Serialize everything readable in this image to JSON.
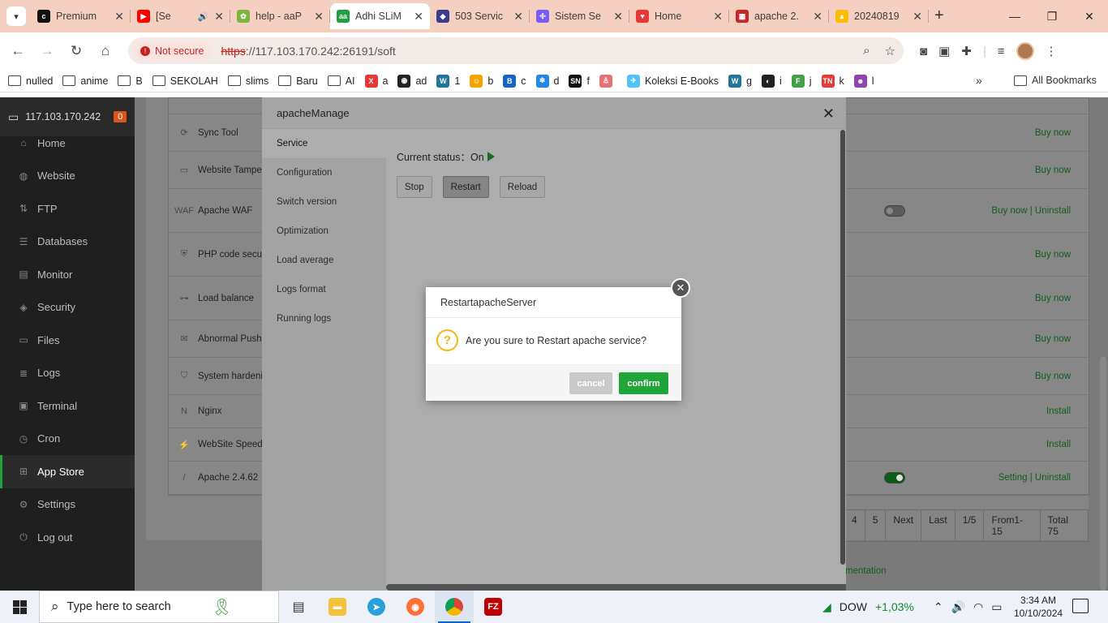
{
  "browser": {
    "tabs": [
      {
        "title": "Premium",
        "color": "#111111",
        "glyph": "c"
      },
      {
        "title": "[Se",
        "color": "#ff0000",
        "glyph": "▶",
        "audio": true
      },
      {
        "title": "help - aaP",
        "color": "#7cb342",
        "glyph": "✿"
      },
      {
        "title": "Adhi SLiM",
        "color": "#1ea043",
        "glyph": "aa",
        "active": true
      },
      {
        "title": "503 Servic",
        "color": "#3c3c8c",
        "glyph": "◆"
      },
      {
        "title": "Sistem Se",
        "color": "#7a5af8",
        "glyph": "✣"
      },
      {
        "title": "Home",
        "color": "#e53935",
        "glyph": "♥"
      },
      {
        "title": "apache 2.",
        "color": "#c62828",
        "glyph": "▦"
      },
      {
        "title": "20240819",
        "color": "#fbbc04",
        "glyph": "▲"
      }
    ],
    "not_secure_label": "Not secure",
    "url_scheme": "https",
    "url_rest": "://117.103.170.242:26191/soft",
    "bookmarks": [
      {
        "label": "nulled",
        "type": "folder"
      },
      {
        "label": "anime",
        "type": "folder"
      },
      {
        "label": "B",
        "type": "folder"
      },
      {
        "label": "SEKOLAH",
        "type": "folder"
      },
      {
        "label": "slims",
        "type": "folder"
      },
      {
        "label": "Baru",
        "type": "folder"
      },
      {
        "label": "AI",
        "type": "folder"
      },
      {
        "label": "a",
        "type": "icon",
        "color": "#e53935",
        "glyph": "X"
      },
      {
        "label": "ad",
        "type": "icon",
        "color": "#222222",
        "glyph": "◉"
      },
      {
        "label": "1",
        "type": "icon",
        "color": "#21759b",
        "glyph": "W"
      },
      {
        "label": "b",
        "type": "icon",
        "color": "#f4a300",
        "glyph": "☺"
      },
      {
        "label": "c",
        "type": "icon",
        "color": "#1565c0",
        "glyph": "B"
      },
      {
        "label": "d",
        "type": "icon",
        "color": "#1e88e5",
        "glyph": "❄"
      },
      {
        "label": "f",
        "type": "icon",
        "color": "#111111",
        "glyph": "SN"
      },
      {
        "label": "",
        "type": "icon",
        "color": "#e57373",
        "glyph": "♙"
      },
      {
        "label": "Koleksi E-Books",
        "type": "icon",
        "color": "#4fc3f7",
        "glyph": "✈"
      },
      {
        "label": "g",
        "type": "icon",
        "color": "#21759b",
        "glyph": "W"
      },
      {
        "label": "i",
        "type": "icon",
        "color": "#222222",
        "glyph": "◐"
      },
      {
        "label": "j",
        "type": "icon",
        "color": "#43a047",
        "glyph": "F"
      },
      {
        "label": "k",
        "type": "icon",
        "color": "#e53935",
        "glyph": "TN"
      },
      {
        "label": "l",
        "type": "icon",
        "color": "#8e44ad",
        "glyph": "☻"
      }
    ],
    "all_bookmarks_label": "All Bookmarks"
  },
  "sidebar": {
    "host": "117.103.170.242",
    "badge": "0",
    "items": [
      {
        "label": "Home",
        "icon": "home-icon",
        "glyph": "⌂"
      },
      {
        "label": "Website",
        "icon": "globe-icon",
        "glyph": "◍"
      },
      {
        "label": "FTP",
        "icon": "ftp-icon",
        "glyph": "⇅"
      },
      {
        "label": "Databases",
        "icon": "database-icon",
        "glyph": "☰"
      },
      {
        "label": "Monitor",
        "icon": "monitor-icon",
        "glyph": "▤"
      },
      {
        "label": "Security",
        "icon": "shield-icon",
        "glyph": "◈"
      },
      {
        "label": "Files",
        "icon": "folder-icon",
        "glyph": "▭"
      },
      {
        "label": "Logs",
        "icon": "logs-icon",
        "glyph": "≣"
      },
      {
        "label": "Terminal",
        "icon": "terminal-icon",
        "glyph": "▣"
      },
      {
        "label": "Cron",
        "icon": "clock-icon",
        "glyph": "◷"
      },
      {
        "label": "App Store",
        "icon": "app-store-icon",
        "glyph": "⊞",
        "active": true
      },
      {
        "label": "Settings",
        "icon": "settings-icon",
        "glyph": "⚙"
      },
      {
        "label": "Log out",
        "icon": "logout-icon",
        "glyph": "⏻"
      }
    ]
  },
  "plugins": [
    {
      "name": "Sync Tool",
      "action": "Buy now",
      "glyph": "⟳"
    },
    {
      "name": "Website Tamper-proo",
      "action": "Buy now",
      "glyph": "▭"
    },
    {
      "name": "Apache WAF",
      "action": "Buy now | Uninstall",
      "glyph": "WAF",
      "toggle": "off"
    },
    {
      "name": "PHP code security",
      "action": "Buy now",
      "glyph": "⛨"
    },
    {
      "name": "Load balance",
      "action": "Buy now",
      "glyph": "⊶"
    },
    {
      "name": "Abnormal Push",
      "action": "Buy now",
      "glyph": "✉"
    },
    {
      "name": "System hardening",
      "action": "Buy now",
      "glyph": "⛉"
    },
    {
      "name": "Nginx",
      "action": "Install",
      "glyph": "N"
    },
    {
      "name": "WebSite Speed",
      "action": "Install",
      "glyph": "⚡"
    },
    {
      "name": "Apache 2.4.62",
      "action": "Setting | Uninstall",
      "glyph": "/",
      "toggle": "on"
    }
  ],
  "pagination": [
    "4",
    "5",
    "Next",
    "Last",
    "1/5",
    "From1-15",
    "Total 75"
  ],
  "doc_link": "mentation",
  "manage_dialog": {
    "title": "apacheManage",
    "nav": [
      "Service",
      "Configuration",
      "Switch version",
      "Optimization",
      "Load average",
      "Logs format",
      "Running logs"
    ],
    "active_nav": "Service",
    "status_label": "Current status：",
    "status_value": "On",
    "buttons": [
      "Stop",
      "Restart",
      "Reload"
    ]
  },
  "confirm_dialog": {
    "title": "RestartapacheServer",
    "message": "Are you sure to Restart apache service?",
    "cancel": "cancel",
    "confirm": "confirm"
  },
  "taskbar": {
    "search_placeholder": "Type here to search",
    "stock_name": "DOW",
    "stock_change": "+1,03%",
    "time": "3:34 AM",
    "date": "10/10/2024",
    "notifications": "1"
  }
}
